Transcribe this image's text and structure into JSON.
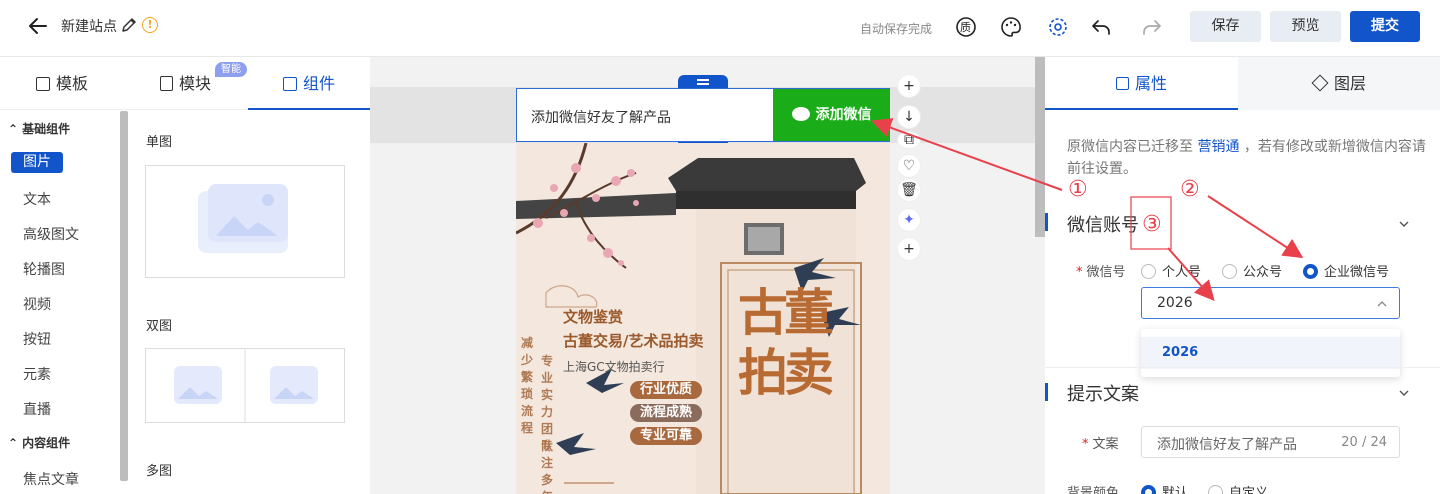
{
  "topbar": {
    "site_title": "新建站点",
    "autosave_text": "自动保存完成",
    "save_label": "保存",
    "preview_label": "预览",
    "submit_label": "提交",
    "quality_icon_text": "质"
  },
  "left": {
    "tabs": [
      {
        "label": "模板"
      },
      {
        "label": "模块"
      },
      {
        "label": "组件"
      }
    ],
    "smart_badge": "智能",
    "categories": {
      "basic_header": "基础组件",
      "basic_items": [
        "图片",
        "文本",
        "高级图文",
        "轮播图",
        "视频",
        "按钮",
        "元素",
        "直播"
      ],
      "content_header": "内容组件",
      "content_items": [
        "焦点文章"
      ]
    },
    "components": {
      "single": "单图",
      "double": "双图",
      "multi": "多图"
    }
  },
  "canvas": {
    "wechat_text": "添加微信好友了解产品",
    "wechat_button": "添加微信",
    "poster": {
      "line1": "文物鉴赏",
      "line2": "古董交易/艺术品拍卖",
      "line3": "上海GC文物拍卖行",
      "tag1": "行业优质",
      "tag2": "流程成熟",
      "tag3": "专业可靠",
      "big_text": "古董拍卖",
      "quote_col1": "减少繁琐流程",
      "quote_col2": "专业实力团队",
      "quote_col3": "专注多年"
    }
  },
  "right": {
    "tabs": [
      {
        "label": "属性"
      },
      {
        "label": "图层"
      }
    ],
    "notice_pre": "原微信内容已迁移至",
    "notice_link": "营销通",
    "notice_post": "，若有修改或新增微信内容请前往设置。",
    "wechat_section": "微信账号",
    "wechat_label": "微信号",
    "radio_options": [
      "个人号",
      "公众号",
      "企业微信号"
    ],
    "selected_value": "2026",
    "dropdown_option": "2026",
    "tip_section": "提示文案",
    "text_label": "文案",
    "text_value": "添加微信好友了解产品",
    "text_count": "20 / 24",
    "bg_label": "背景颜色",
    "bg_options": [
      "默认",
      "自定义"
    ]
  },
  "annotations": {
    "mark1": "①",
    "mark2": "②",
    "mark3": "③",
    "color": "#e8414b"
  }
}
